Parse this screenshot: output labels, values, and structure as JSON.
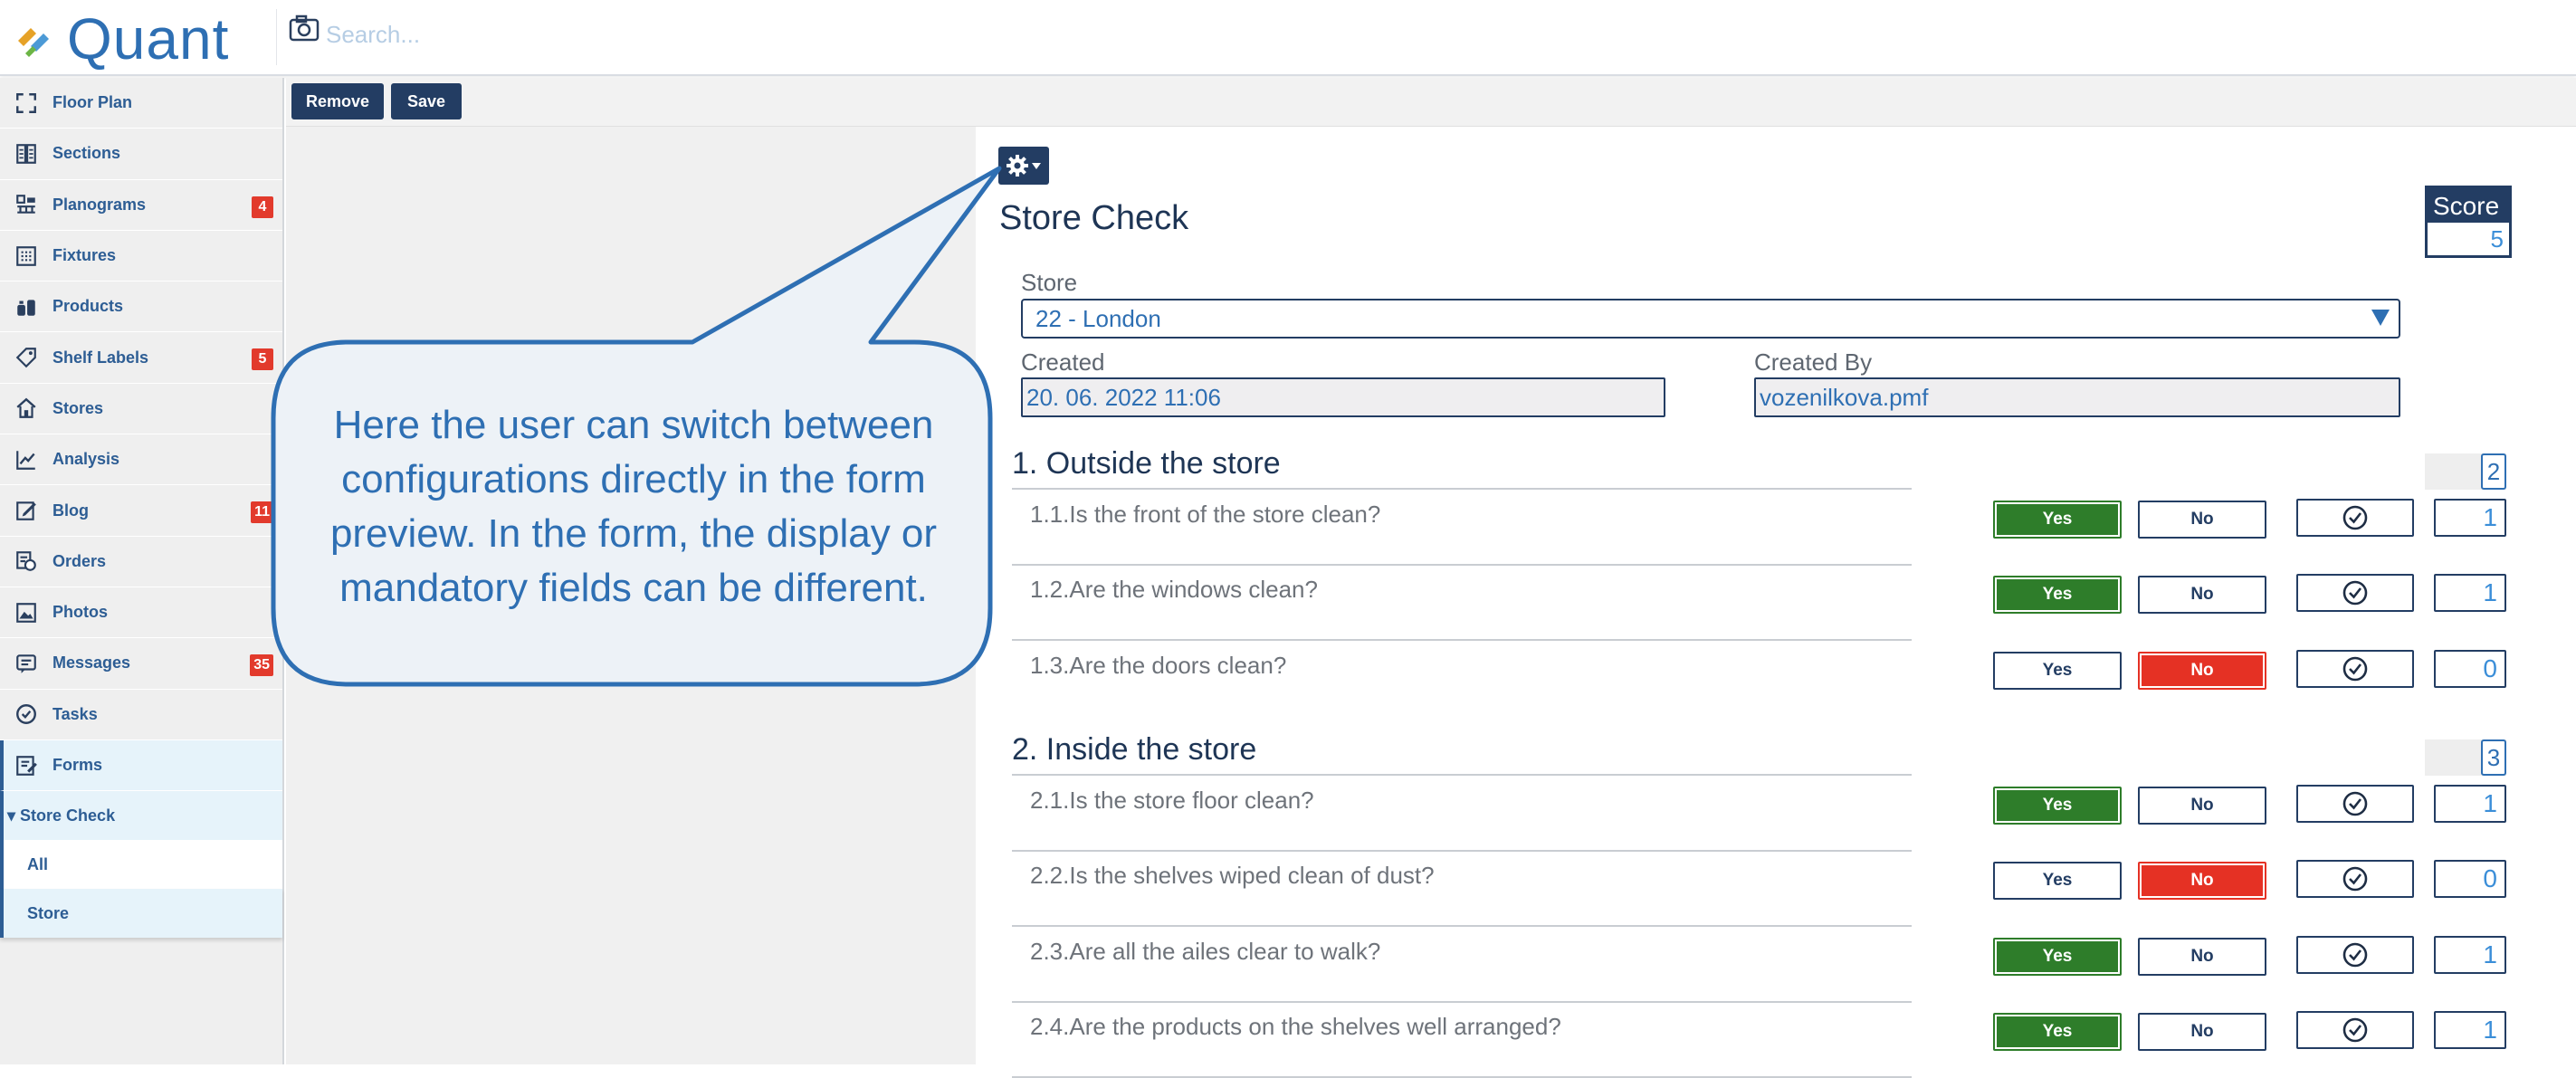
{
  "app": {
    "brand": "Quant"
  },
  "search": {
    "placeholder": "Search..."
  },
  "sidebar": {
    "items": [
      {
        "label": "Floor Plan",
        "icon": "floor-plan-icon",
        "badge": ""
      },
      {
        "label": "Sections",
        "icon": "sections-icon",
        "badge": ""
      },
      {
        "label": "Planograms",
        "icon": "planograms-icon",
        "badge": "4"
      },
      {
        "label": "Fixtures",
        "icon": "fixtures-icon",
        "badge": ""
      },
      {
        "label": "Products",
        "icon": "products-icon",
        "badge": ""
      },
      {
        "label": "Shelf Labels",
        "icon": "tag-icon",
        "badge": "5"
      },
      {
        "label": "Stores",
        "icon": "store-icon",
        "badge": ""
      },
      {
        "label": "Analysis",
        "icon": "analysis-icon",
        "badge": ""
      },
      {
        "label": "Blog",
        "icon": "blog-icon",
        "badge": "11"
      },
      {
        "label": "Orders",
        "icon": "orders-icon",
        "badge": ""
      },
      {
        "label": "Photos",
        "icon": "photo-icon",
        "badge": ""
      },
      {
        "label": "Messages",
        "icon": "messages-icon",
        "badge": "35"
      },
      {
        "label": "Tasks",
        "icon": "tasks-icon",
        "badge": ""
      },
      {
        "label": "Forms",
        "icon": "forms-icon",
        "badge": ""
      }
    ],
    "group": "▾ Store Check",
    "subitems": [
      "All",
      "Store"
    ]
  },
  "toolbar": {
    "remove_label": "Remove",
    "save_label": "Save"
  },
  "form": {
    "title": "Store Check",
    "score_label": "Score",
    "score_value": "5",
    "store_label": "Store",
    "store_value": "22 - London",
    "created_label": "Created",
    "created_value": "20. 06. 2022 11:06",
    "created_by_label": "Created By",
    "created_by_value": "vozenilkova.pmf",
    "yes_label": "Yes",
    "no_label": "No",
    "sections": [
      {
        "title": "1. Outside the store",
        "score": "2",
        "questions": [
          {
            "text": "1.1.Is the front of the store clean?",
            "answer": "yes",
            "value": "1"
          },
          {
            "text": "1.2.Are the windows clean?",
            "answer": "yes",
            "value": "1"
          },
          {
            "text": "1.3.Are the doors clean?",
            "answer": "no",
            "value": "0"
          }
        ]
      },
      {
        "title": "2. Inside the store",
        "score": "3",
        "questions": [
          {
            "text": "2.1.Is the store floor clean?",
            "answer": "yes",
            "value": "1"
          },
          {
            "text": "2.2.Is the shelves wiped clean of dust?",
            "answer": "no",
            "value": "0"
          },
          {
            "text": "2.3.Are all the ailes clear to walk?",
            "answer": "yes",
            "value": "1"
          },
          {
            "text": "2.4.Are the products on the shelves well arranged?",
            "answer": "yes",
            "value": "1"
          }
        ]
      }
    ]
  },
  "callout": {
    "text": "Here the user can switch between configurations directly in the form preview. In the form, the display or mandatory fields can be different."
  },
  "colors": {
    "navy": "#233d63",
    "brand_blue": "#2e6fb3",
    "yes_green": "#2e7d2a",
    "no_red": "#e53124",
    "badge_red": "#e23a2c"
  }
}
